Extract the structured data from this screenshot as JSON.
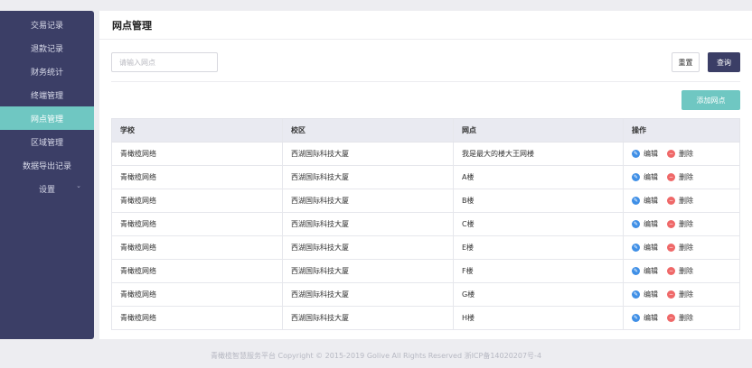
{
  "sidebar": {
    "items": [
      {
        "label": "交易记录"
      },
      {
        "label": "退款记录"
      },
      {
        "label": "财务统计"
      },
      {
        "label": "终端管理"
      },
      {
        "label": "网点管理"
      },
      {
        "label": "区域管理"
      },
      {
        "label": "数据导出记录"
      },
      {
        "label": "设置"
      }
    ],
    "active_index": 4
  },
  "header": {
    "title": "网点管理"
  },
  "search": {
    "placeholder": "请输入网点",
    "reset_label": "重置",
    "query_label": "查询"
  },
  "add_button": "添加网点",
  "table": {
    "columns": [
      "学校",
      "校区",
      "网点",
      "操作"
    ],
    "rows": [
      {
        "school": "青橄榄网络",
        "campus": "西湖国际科技大厦",
        "point": "我是最大的楼大王网楼"
      },
      {
        "school": "青橄榄网络",
        "campus": "西湖国际科技大厦",
        "point": "A楼"
      },
      {
        "school": "青橄榄网络",
        "campus": "西湖国际科技大厦",
        "point": "B楼"
      },
      {
        "school": "青橄榄网络",
        "campus": "西湖国际科技大厦",
        "point": "C楼"
      },
      {
        "school": "青橄榄网络",
        "campus": "西湖国际科技大厦",
        "point": "E楼"
      },
      {
        "school": "青橄榄网络",
        "campus": "西湖国际科技大厦",
        "point": "F楼"
      },
      {
        "school": "青橄榄网络",
        "campus": "西湖国际科技大厦",
        "point": "G楼"
      },
      {
        "school": "青橄榄网络",
        "campus": "西湖国际科技大厦",
        "point": "H楼"
      }
    ],
    "edit_label": "编辑",
    "delete_label": "删除"
  },
  "footer": "青橄榄智慧服务平台 Copyright © 2015-2019 Golive All Rights Reserved  浙ICP备14020207号-4",
  "colors": {
    "sidebar": "#3b3e66",
    "accent": "#6fc7c2",
    "query": "#3b3e66",
    "edit": "#3f8fe6",
    "delete": "#ef6868"
  }
}
